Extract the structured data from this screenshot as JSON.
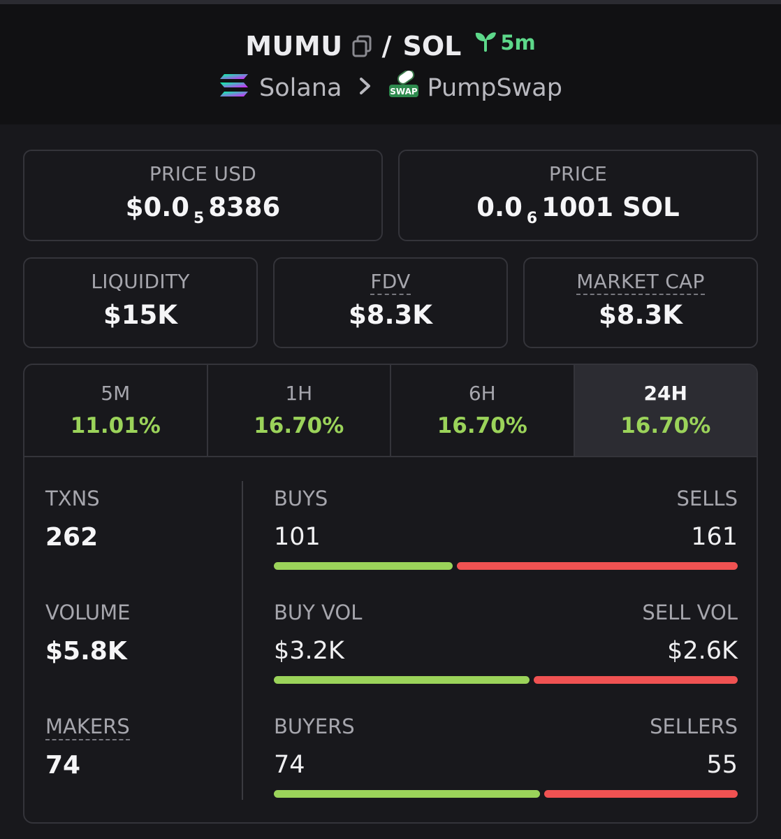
{
  "header": {
    "token": "MUMU",
    "slash": "/",
    "quote": "SOL",
    "age": "5m",
    "chain": "Solana",
    "dex": "PumpSwap",
    "age_color": "#5dd88a"
  },
  "price_usd": {
    "label": "PRICE USD",
    "prefix": "$0.0",
    "sub": "5",
    "suffix": "8386"
  },
  "price_native": {
    "label": "PRICE",
    "prefix": "0.0",
    "sub": "6",
    "suffix": "1001 SOL"
  },
  "liquidity": {
    "label": "LIQUIDITY",
    "value": "$15K"
  },
  "fdv": {
    "label": "FDV",
    "value": "$8.3K"
  },
  "market_cap": {
    "label": "MARKET CAP",
    "value": "$8.3K"
  },
  "tabs": [
    {
      "label": "5M",
      "value": "11.01%"
    },
    {
      "label": "1H",
      "value": "16.70%"
    },
    {
      "label": "6H",
      "value": "16.70%"
    },
    {
      "label": "24H",
      "value": "16.70%"
    }
  ],
  "active_tab": "24H",
  "stats": {
    "txns": {
      "label": "TXNS",
      "value": "262"
    },
    "volume": {
      "label": "VOLUME",
      "value": "$5.8K"
    },
    "makers": {
      "label": "MAKERS",
      "value": "74"
    }
  },
  "splits": {
    "buys": {
      "left_label": "BUYS",
      "left_value": "101",
      "right_label": "SELLS",
      "right_value": "161",
      "buy_fraction": 0.3855
    },
    "vol": {
      "left_label": "BUY VOL",
      "left_value": "$3.2K",
      "right_label": "SELL VOL",
      "right_value": "$2.6K",
      "buy_fraction": 0.5517
    },
    "buyers": {
      "left_label": "BUYERS",
      "left_value": "74",
      "right_label": "SELLERS",
      "right_value": "55",
      "buy_fraction": 0.5736
    }
  },
  "colors": {
    "positive": "#9bd35a",
    "negative": "#f05252",
    "background": "#18181c"
  }
}
